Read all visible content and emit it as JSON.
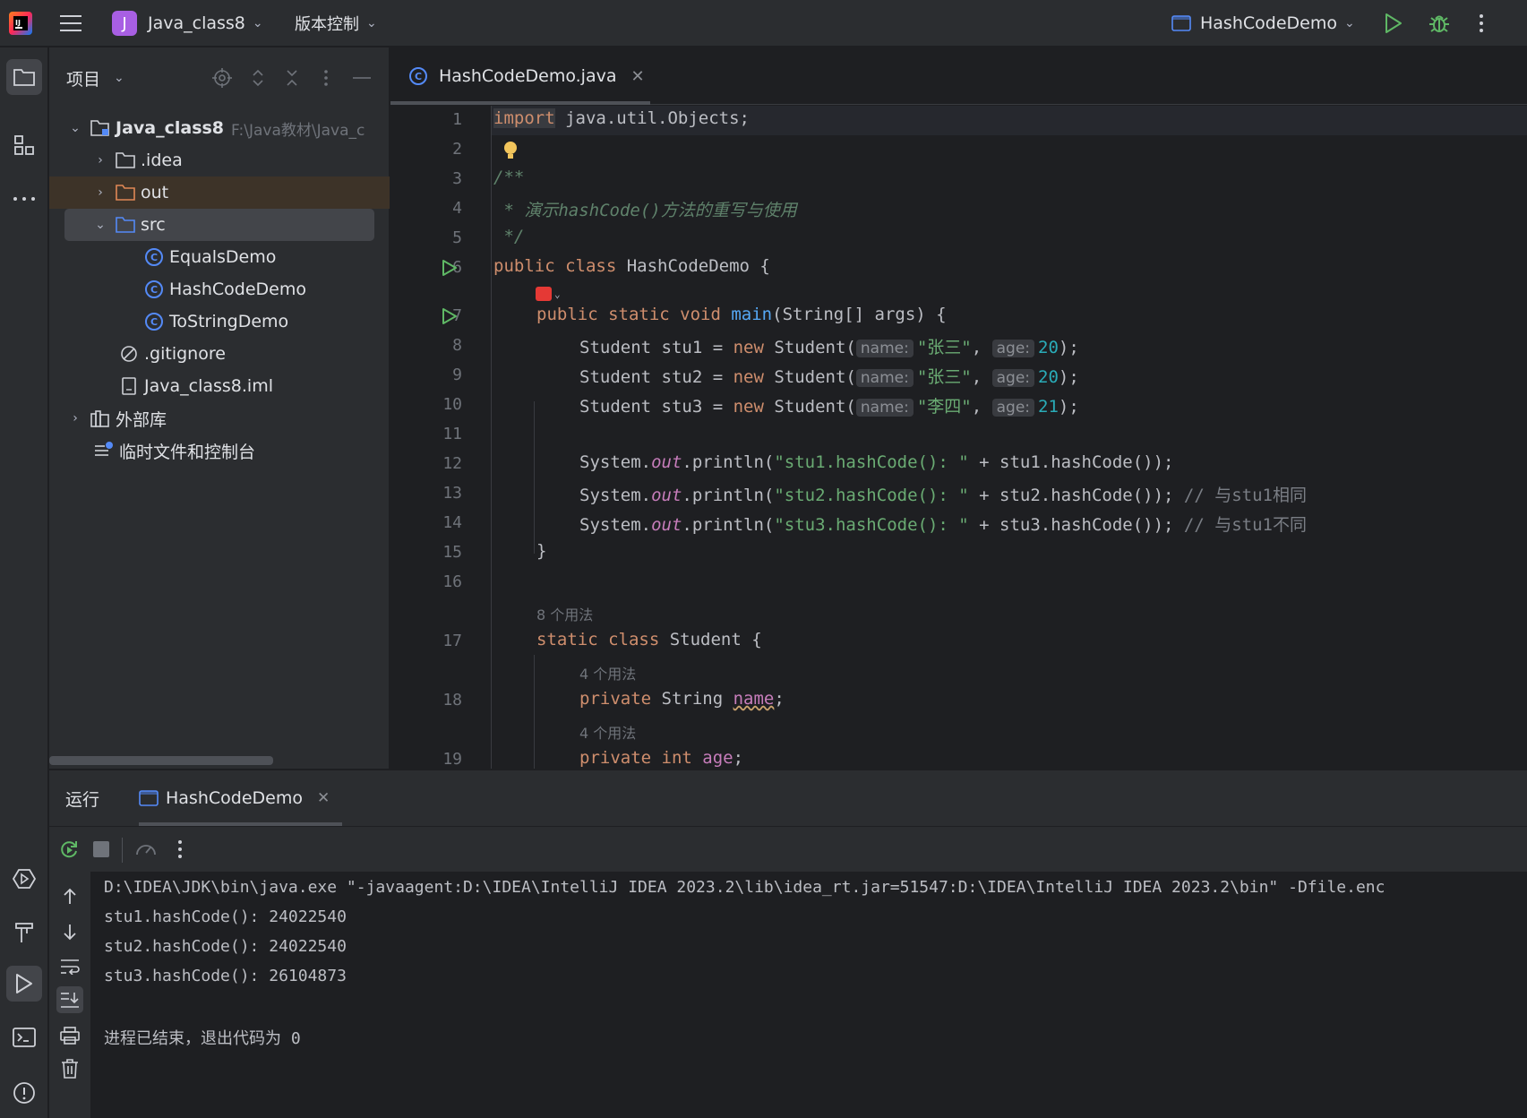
{
  "titlebar": {
    "project_badge": "J",
    "project_name": "Java_class8",
    "vcs_label": "版本控制",
    "run_config": "HashCodeDemo"
  },
  "project_panel": {
    "title": "项目",
    "tree": [
      {
        "label": "Java_class8",
        "path": "F:\\Java教材\\Java_c",
        "type": "module"
      },
      {
        "label": ".idea",
        "type": "folder"
      },
      {
        "label": "out",
        "type": "folder-excluded"
      },
      {
        "label": "src",
        "type": "folder-source"
      },
      {
        "label": "EqualsDemo",
        "type": "class"
      },
      {
        "label": "HashCodeDemo",
        "type": "class"
      },
      {
        "label": "ToStringDemo",
        "type": "class"
      },
      {
        "label": ".gitignore",
        "type": "ignore"
      },
      {
        "label": "Java_class8.iml",
        "type": "iml"
      },
      {
        "label": "外部库",
        "type": "library"
      },
      {
        "label": "临时文件和控制台",
        "type": "scratch"
      }
    ]
  },
  "editor": {
    "tab_label": "HashCodeDemo.java",
    "line_numbers": [
      "1",
      "2",
      "3",
      "4",
      "5",
      "6",
      "7",
      "8",
      "9",
      "10",
      "11",
      "12",
      "13",
      "14",
      "15",
      "16",
      "17",
      "18",
      "19"
    ],
    "code": {
      "l1_kw": "import",
      "l1_rest": " java.util.Objects;",
      "l3": "/**",
      "l4_a": " * 演示",
      "l4_b": "hashCode()",
      "l4_c": "方法的重写与使用",
      "l5": " */",
      "l6_kw": "public class",
      "l6_rest": " HashCodeDemo {",
      "l7_kw": "public static void",
      "l7_fn": "main",
      "l7_rest": "(String[] args) {",
      "stu_prefix1": "Student stu1 = ",
      "stu_prefix2": "Student stu2 = ",
      "stu_prefix3": "Student stu3 = ",
      "new_kw": "new",
      "ctor": " Student(",
      "hint_name": "name:",
      "hint_age": "age:",
      "name1": "\"张三\"",
      "name2": "\"张三\"",
      "name3": "\"李四\"",
      "comma": ", ",
      "age1": "20",
      "age2": "20",
      "age3": "21",
      "close": ");",
      "sys": "System.",
      "out": "out",
      "println": ".println(",
      "s1": "\"stu1.hashCode(): \"",
      "s2": "\"stu2.hashCode(): \"",
      "s3": "\"stu3.hashCode(): \"",
      "plus1": " + stu1.hashCode());",
      "plus2": " + stu2.hashCode());",
      "plus3": " + stu3.hashCode());",
      "c13": " // 与stu1相同",
      "c14": " // 与stu1不同",
      "l15": "}",
      "usage8": "8 个用法",
      "l17_kw": "static class",
      "l17_rest": " Student {",
      "usage4a": "4 个用法",
      "l18_kw": "private",
      "l18_mid": " String ",
      "l18_fld": "name",
      "l18_end": ";",
      "usage4b": "4 个用法",
      "l19_kw": "private int",
      "l19_fld": "age",
      "l19_end": ";"
    }
  },
  "run_panel": {
    "title": "运行",
    "tab_label": "HashCodeDemo",
    "console": [
      "D:\\IDEA\\JDK\\bin\\java.exe \"-javaagent:D:\\IDEA\\IntelliJ IDEA 2023.2\\lib\\idea_rt.jar=51547:D:\\IDEA\\IntelliJ IDEA 2023.2\\bin\" -Dfile.enc",
      "stu1.hashCode(): 24022540",
      "stu2.hashCode(): 24022540",
      "stu3.hashCode(): 26104873",
      "",
      "进程已结束，退出代码为 0"
    ]
  },
  "colors": {
    "keyword": "#cf8e6d",
    "string": "#6aab73",
    "number": "#2aacb8",
    "function": "#56a8f5",
    "accent": "#548af7"
  }
}
